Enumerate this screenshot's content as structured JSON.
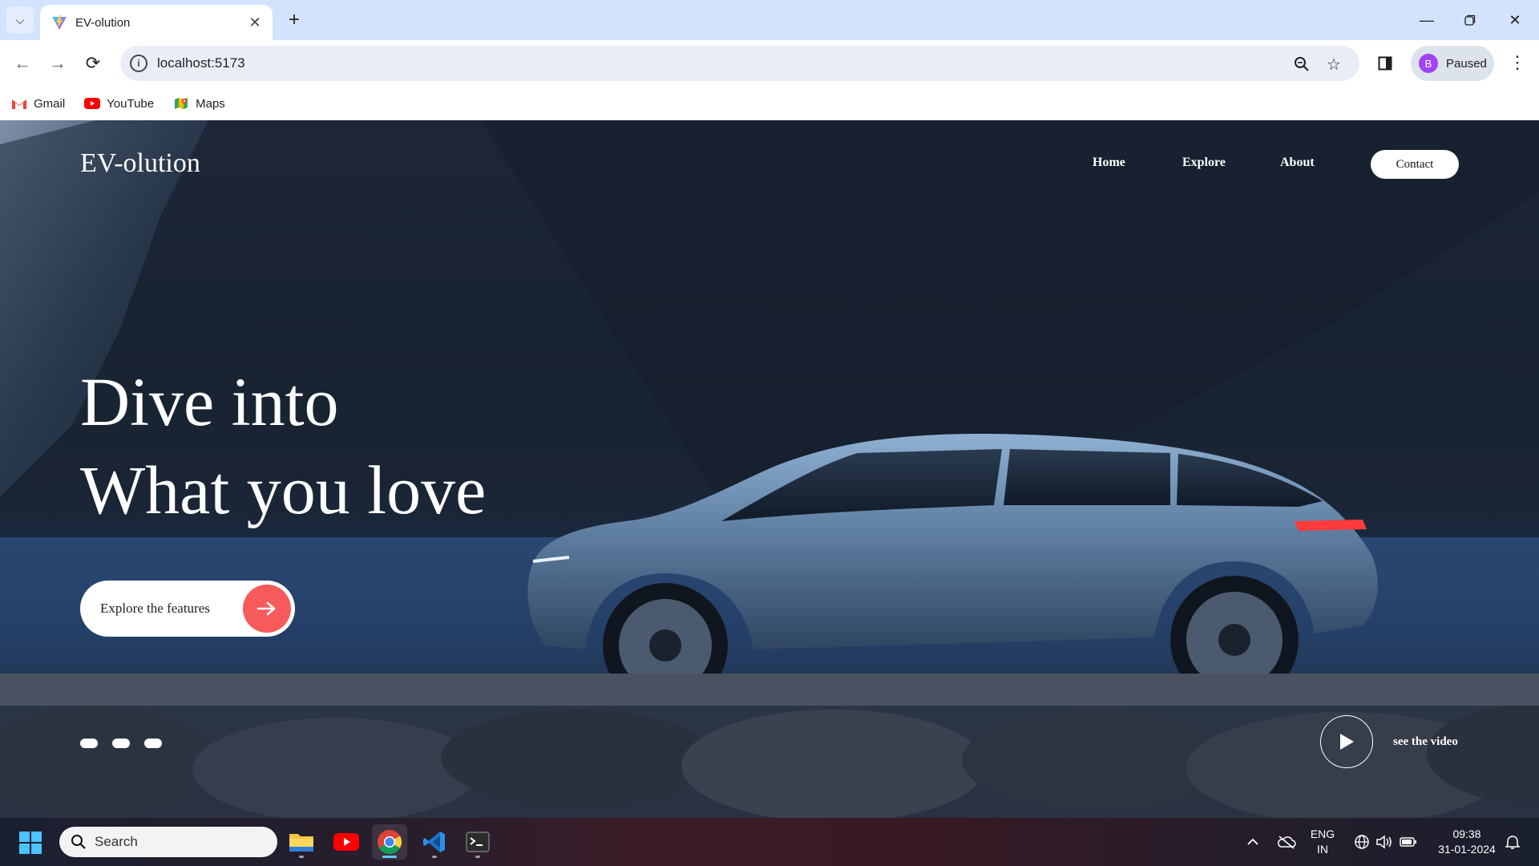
{
  "browser": {
    "tab_title": "EV-olution",
    "url": "localhost:5173",
    "profile_initial": "B",
    "profile_status": "Paused",
    "bookmarks": [
      {
        "label": "Gmail",
        "icon": "gmail-icon"
      },
      {
        "label": "YouTube",
        "icon": "youtube-icon"
      },
      {
        "label": "Maps",
        "icon": "maps-icon"
      }
    ]
  },
  "site": {
    "logo": "EV-olution",
    "nav": [
      "Home",
      "Explore",
      "About"
    ],
    "contact_label": "Contact",
    "hero_lines": [
      "Dive into",
      "What you love"
    ],
    "cta_label": "Explore the features",
    "video_label": "see the video",
    "slide_dots": 3,
    "accent_color": "#f75a5a"
  },
  "taskbar": {
    "search_placeholder": "Search",
    "apps": [
      "file-explorer-icon",
      "youtube-icon",
      "chrome-icon",
      "vscode-icon",
      "terminal-icon"
    ],
    "language": "ENG",
    "region": "IN",
    "time": "09:38",
    "date": "31-01-2024"
  }
}
